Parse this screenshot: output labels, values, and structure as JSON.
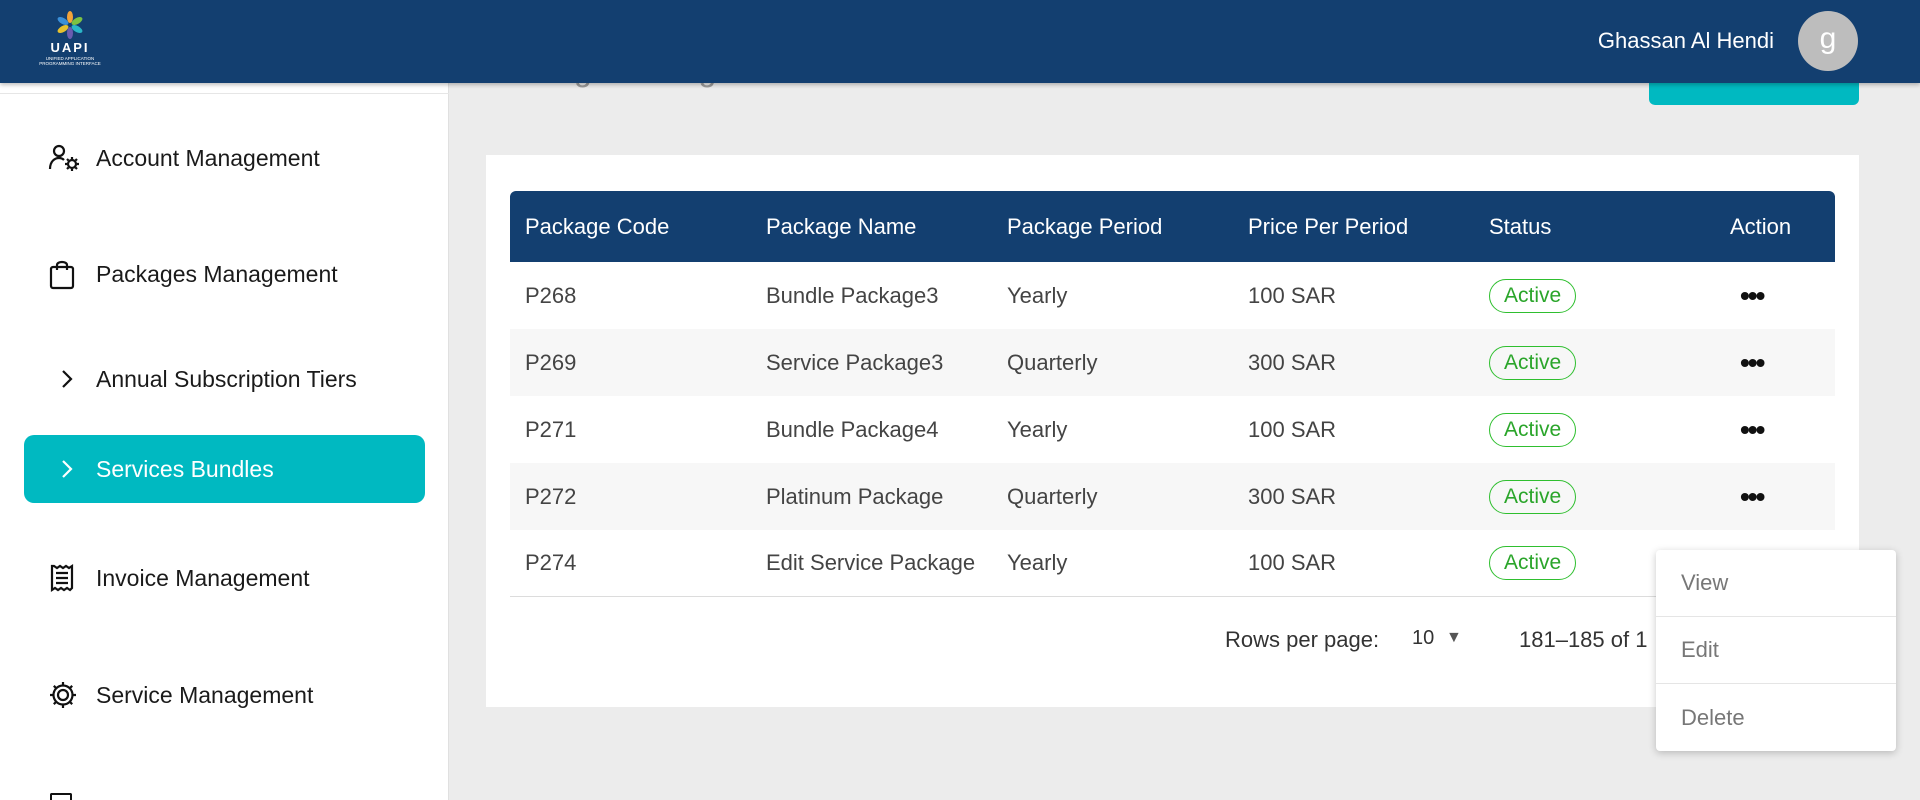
{
  "header": {
    "logo_text": "UAPI",
    "logo_subtitle": "UNIFIED APPLICATION PROGRAMMING INTERFACE",
    "user_name": "Ghassan Al Hendi",
    "avatar_initial": "g"
  },
  "sidebar": {
    "items": [
      {
        "label": "Account Management",
        "icon": "user-gear-icon"
      },
      {
        "label": "Packages Management",
        "icon": "shopping-bag-icon"
      },
      {
        "label": "Annual Subscription Tiers",
        "icon": "chevron-right-icon"
      },
      {
        "label": "Services Bundles",
        "icon": "chevron-right-icon",
        "active": true
      },
      {
        "label": "Invoice Management",
        "icon": "receipt-icon"
      },
      {
        "label": "Service Management",
        "icon": "gear-icon"
      }
    ]
  },
  "page": {
    "title": "Package Management > Services Bundles"
  },
  "table": {
    "headers": [
      "Package Code",
      "Package Name",
      "Package Period",
      "Price Per Period",
      "Status",
      "Action"
    ],
    "rows": [
      {
        "code": "P268",
        "name": "Bundle Package3",
        "period": "Yearly",
        "price": "100 SAR",
        "status": "Active"
      },
      {
        "code": "P269",
        "name": "Service Package3",
        "period": "Quarterly",
        "price": "300 SAR",
        "status": "Active"
      },
      {
        "code": "P271",
        "name": "Bundle Package4",
        "period": "Yearly",
        "price": "100 SAR",
        "status": "Active"
      },
      {
        "code": "P272",
        "name": "Platinum Package",
        "period": "Quarterly",
        "price": "300 SAR",
        "status": "Active"
      },
      {
        "code": "P274",
        "name": "Edit Service Package",
        "period": "Yearly",
        "price": "100 SAR",
        "status": "Active"
      }
    ],
    "action_glyph": "•••"
  },
  "pagination": {
    "rows_per_page_label": "Rows per page:",
    "rows_per_page_value": "10",
    "range": "181–185 of 1"
  },
  "action_menu": {
    "items": [
      "View",
      "Edit",
      "Delete"
    ]
  },
  "colors": {
    "header_bg": "#133f70",
    "accent": "#00b9c1",
    "status_active": "#2aa52a"
  }
}
